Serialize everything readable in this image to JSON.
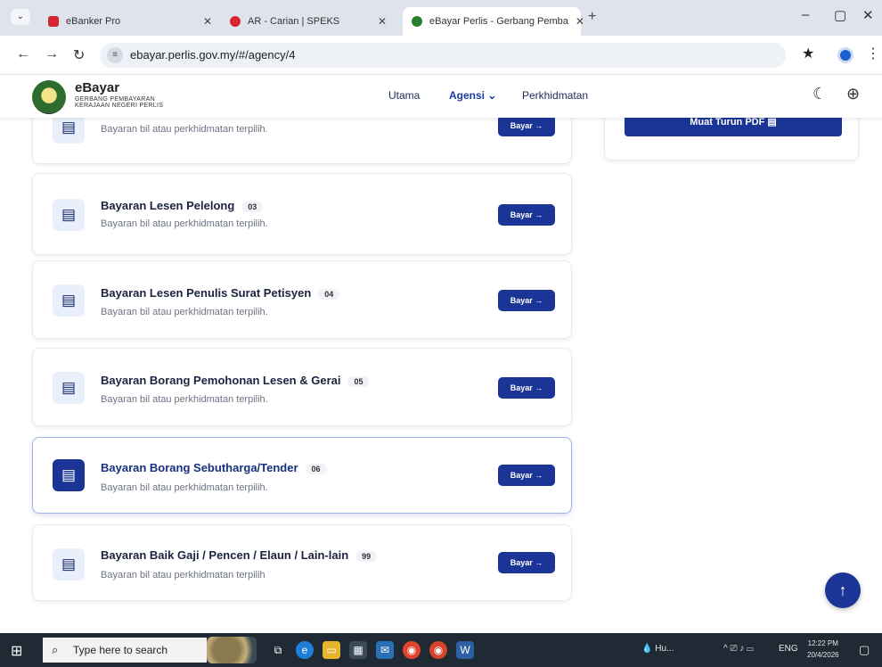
{
  "browser": {
    "tabs": [
      {
        "label": "eBanker Pro",
        "color": "#d6262f"
      },
      {
        "label": "AR - Carian | SPEKS",
        "color": "#d6262f"
      },
      {
        "label": "eBayar Perlis - Gerbang Pemba",
        "color": "#2a7d2e"
      }
    ],
    "new_tab_icon": "plus-icon",
    "url": "ebayar.perlis.gov.my/#/agency/4"
  },
  "header": {
    "brand_name": "eBayar",
    "brand_sub1": "GERBANG PEMBAYARAN",
    "brand_sub2": "KERAJAAN NEGERI PERLIS",
    "nav": {
      "home": "Utama",
      "agency": "Agensi",
      "services": "Perkhidmatan"
    }
  },
  "side_panel": {
    "download_label": "Muat Turun PDF"
  },
  "services": [
    {
      "title": "",
      "code": "",
      "desc": "Bayaran bil atau perkhidmatan terpilih.",
      "button": "Bayar"
    },
    {
      "title": "Bayaran Lesen Pelelong",
      "code": "03",
      "desc": "Bayaran bil atau perkhidmatan terpilih.",
      "button": "Bayar"
    },
    {
      "title": "Bayaran Lesen Penulis Surat Petisyen",
      "code": "04",
      "desc": "Bayaran bil atau perkhidmatan terpilih.",
      "button": "Bayar"
    },
    {
      "title": "Bayaran Borang Pemohonan Lesen & Gerai",
      "code": "05",
      "desc": "Bayaran bil atau perkhidmatan terpilih.",
      "button": "Bayar"
    },
    {
      "title": "Bayaran Borang Sebutharga/Tender",
      "code": "06",
      "desc": "Bayaran bil atau perkhidmatan terpilih.",
      "button": "Bayar"
    },
    {
      "title": "Bayaran Baik Gaji / Pencen / Elaun / Lain-lain",
      "code": "99",
      "desc": "Bayaran bil atau perkhidmatan terpilih",
      "button": "Bayar"
    }
  ],
  "taskbar": {
    "search_placeholder": "Type here to search",
    "tray_app": "Hu...",
    "lang": "ENG",
    "time": "12:22 PM",
    "date": "20/4/2026"
  },
  "colors": {
    "primary": "#1b3596",
    "accent_green": "#2a7d2e"
  }
}
